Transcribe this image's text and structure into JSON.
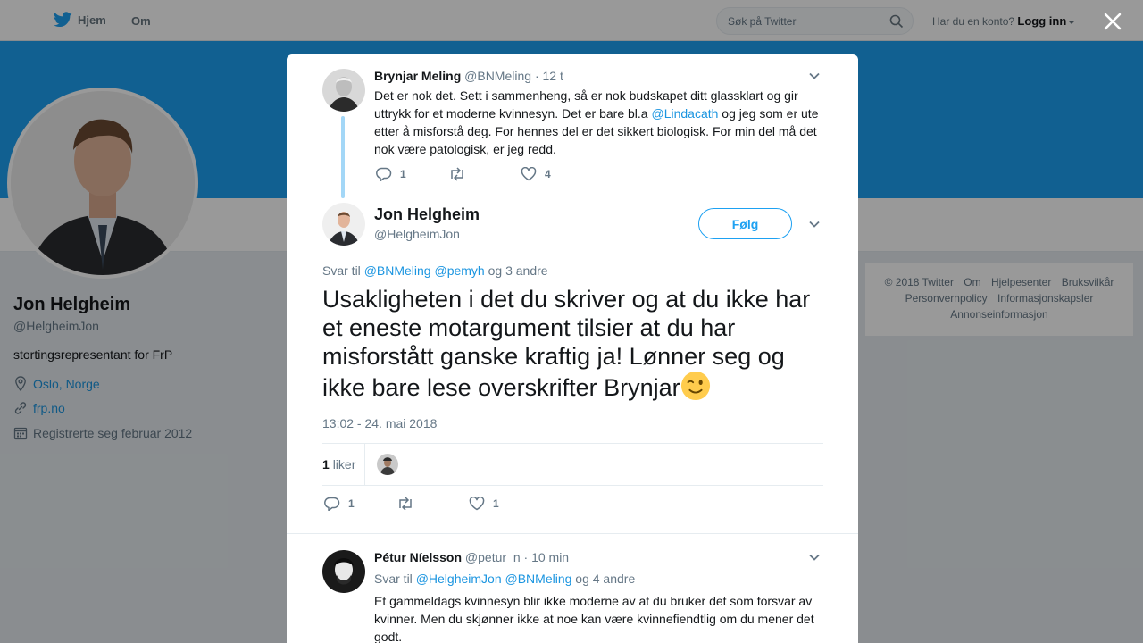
{
  "topbar": {
    "home_label": "Hjem",
    "about_label": "Om",
    "search_placeholder": "Søk på Twitter",
    "account_prompt": "Har du en konto?",
    "login_label": "Logg inn"
  },
  "profile": {
    "name": "Jon Helgheim",
    "handle": "@HelgheimJon",
    "bio": "stortingsrepresentant for FrP",
    "location": "Oslo, Norge",
    "website": "frp.no",
    "joined": "Registrerte seg februar 2012"
  },
  "footer": {
    "links": [
      "© 2018 Twitter",
      "Om",
      "Hjelpesenter",
      "Bruksvilkår",
      "Personvernpolicy",
      "Informasjonskapsler",
      "Annonseinformasjon"
    ]
  },
  "modal": {
    "parent_tweet": {
      "name": "Brynjar Meling",
      "handle": "@BNMeling",
      "time": "· 12 t",
      "text_before": "Det er nok det. Sett i sammenheng, så er nok budskapet ditt glassklart og gir uttrykk for et moderne kvinnesyn. Det er bare bl.a ",
      "mention": "@Lindacath",
      "text_after": " og jeg som er ute etter å misforstå deg. For hennes del er det sikkert biologisk. For min del må det nok være patologisk, er jeg redd.",
      "replies": "1",
      "retweets": "",
      "likes": "4"
    },
    "main_tweet": {
      "name": "Jon Helgheim",
      "handle": "@HelgheimJon",
      "follow_label": "Følg",
      "reply_prefix": "Svar til",
      "reply_mention1": "@BNMeling",
      "reply_mention2": "@pemyh",
      "reply_suffix": "og 3 andre",
      "text": "Usakligheten i det du skriver og at du ikke har et eneste motargument tilsier at du har misforstått ganske kraftig ja! Lønner seg og ikke bare lese overskrifter Brynjar",
      "timestamp": "13:02 - 24. mai 2018",
      "like_count": "1",
      "like_label": "liker",
      "replies": "1",
      "retweets": "",
      "likes": "1"
    },
    "reply_tweet": {
      "name": "Pétur Níelsson",
      "handle": "@petur_n",
      "time": "· 10 min",
      "reply_prefix": "Svar til",
      "reply_mention1": "@HelgheimJon",
      "reply_mention2": "@BNMeling",
      "reply_suffix": "og 4 andre",
      "text": "Et gammeldags kvinnesyn blir ikke moderne av at du bruker det som forsvar av kvinner. Men du skjønner ikke at noe kan være kvinnefiendtlig om du mener det godt."
    }
  },
  "colors": {
    "brand": "#1da1f2",
    "link": "#1b95e0",
    "muted": "#657786"
  }
}
